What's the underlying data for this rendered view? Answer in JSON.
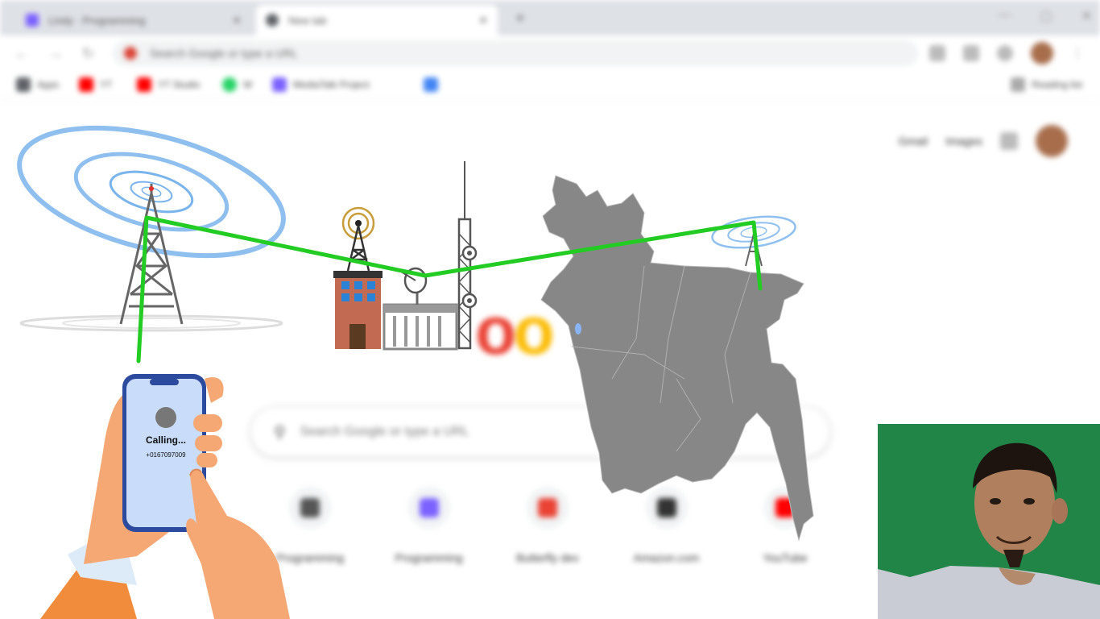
{
  "browser": {
    "tabs": [
      {
        "label": "Lindy · Programming",
        "close": "✕"
      },
      {
        "label": "New tab",
        "close": "✕"
      }
    ],
    "new_tab": "+",
    "window_buttons": [
      "—",
      "▢",
      "✕"
    ],
    "nav": {
      "back": "←",
      "forward": "→",
      "reload": "↻"
    },
    "omnibox_placeholder": "Search Google or type a URL",
    "bookmarks": [
      {
        "label": "Apps",
        "color": "#5f6368"
      },
      {
        "label": "YT",
        "color": "#ff0000"
      },
      {
        "label": "YT Studio",
        "color": "#ff0000"
      },
      {
        "label": "W",
        "color": "#25d366"
      },
      {
        "label": "MediaTalk Project",
        "color": "#7b61ff"
      },
      {
        "label": "",
        "color": "#4285f4"
      }
    ],
    "reading_list": "Reading list"
  },
  "newtab": {
    "top_links": [
      "Gmail",
      "Images"
    ],
    "logo_letters": [
      "o",
      "o"
    ],
    "search_placeholder": "Search Google or type a URL",
    "shortcuts": [
      {
        "label": "Programming",
        "color": "#555555"
      },
      {
        "label": "Programming",
        "color": "#7b61ff"
      },
      {
        "label": "Butterfly dev",
        "color": "#ea4335"
      },
      {
        "label": "Amazon.com",
        "color": "#333333"
      },
      {
        "label": "YouTube",
        "color": "#ff0000"
      }
    ]
  },
  "illustration": {
    "phone_status": "Calling...",
    "phone_number": "+0167097009",
    "link_color": "#22cc22",
    "map_color": "#878787"
  },
  "colors": {
    "tower_rings": "#7ab4ec",
    "building_brick": "#c26a52",
    "skin": "#f5a874",
    "sleeve": "#f08c3c",
    "phone_body": "#2c4a9e",
    "phone_screen": "#c9dcf9",
    "webcam_bg": "#1e7d43"
  }
}
